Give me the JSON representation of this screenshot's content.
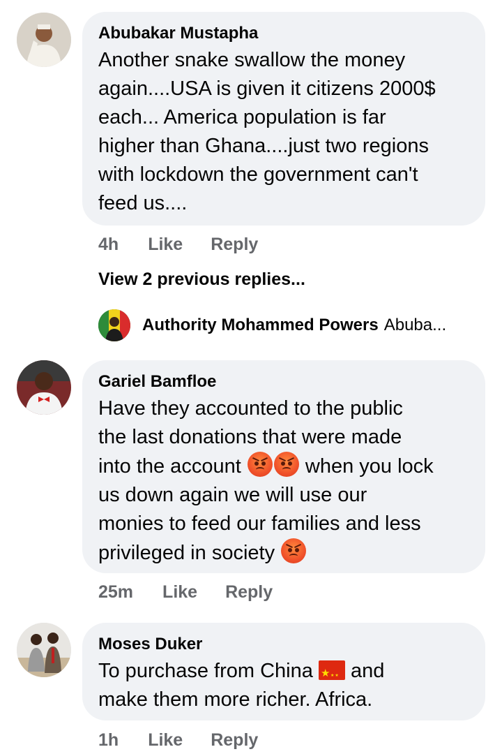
{
  "comments": [
    {
      "author": "Abubakar Mustapha",
      "lines": [
        "Another snake swallow the money",
        "again....USA is given it citizens 2000$",
        "each... America population is far",
        "higher than Ghana....just two regions",
        "with lockdown  the government can't",
        "feed us...."
      ],
      "time": "4h",
      "like": "Like",
      "reply": "Reply"
    },
    {
      "author": "Gariel Bamfloe",
      "lines": [
        "Have they accounted to the public",
        "the last donations that were made",
        "into the account",
        "when you lock",
        "us down again we will use our",
        "monies to feed our families and less",
        "privileged in society"
      ],
      "time": "25m",
      "like": "Like",
      "reply": "Reply"
    },
    {
      "author": "Moses Duker",
      "lines": [
        "To purchase from China",
        "and",
        "make them more richer.  Africa."
      ],
      "time": "1h",
      "like": "Like",
      "reply": "Reply"
    }
  ],
  "view_previous": "View 2 previous replies...",
  "reply_preview": {
    "author": "Authority Mohammed Powers",
    "snippet": "Abuba..."
  },
  "icons": {
    "angry": "angry-face-emoji",
    "flag": "china-flag-emoji"
  },
  "colors": {
    "bubble": "#f0f2f5",
    "meta": "#65676b",
    "text": "#050505"
  }
}
